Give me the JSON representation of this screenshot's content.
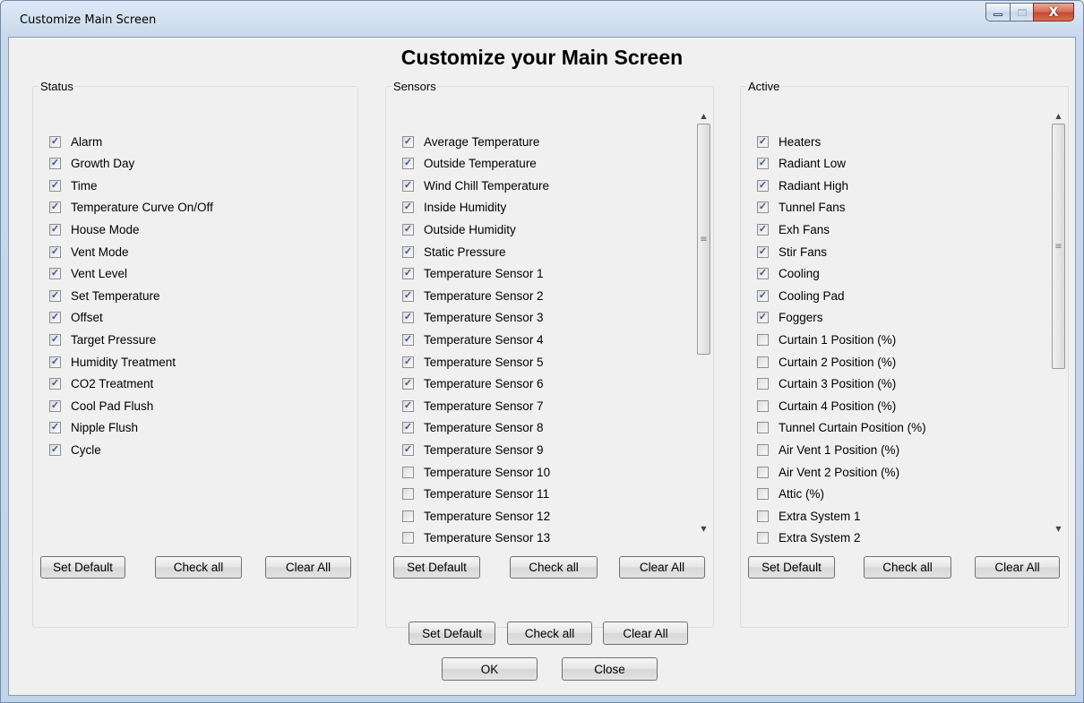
{
  "window": {
    "title": "Customize Main Screen",
    "controls": {
      "minimize": "minimize-icon",
      "maximize": "maximize-icon",
      "close": "close-icon",
      "close_glyph": "X"
    }
  },
  "heading": "Customize your Main Screen",
  "groups": [
    {
      "title": "Status",
      "items": [
        {
          "label": "Alarm",
          "checked": true
        },
        {
          "label": "Growth Day",
          "checked": true
        },
        {
          "label": "Time",
          "checked": true
        },
        {
          "label": "Temperature Curve On/Off",
          "checked": true
        },
        {
          "label": "House Mode",
          "checked": true
        },
        {
          "label": "Vent Mode",
          "checked": true
        },
        {
          "label": "Vent Level",
          "checked": true
        },
        {
          "label": "Set Temperature",
          "checked": true
        },
        {
          "label": "Offset",
          "checked": true
        },
        {
          "label": "Target Pressure",
          "checked": true
        },
        {
          "label": "Humidity Treatment",
          "checked": true
        },
        {
          "label": "CO2 Treatment",
          "checked": true
        },
        {
          "label": "Cool Pad Flush",
          "checked": true
        },
        {
          "label": "Nipple Flush",
          "checked": true
        },
        {
          "label": "Cycle",
          "checked": true
        }
      ],
      "buttons": {
        "set_default": "Set Default",
        "check_all": "Check all",
        "clear_all": "Clear All"
      }
    },
    {
      "title": "Sensors",
      "items": [
        {
          "label": "Average Temperature",
          "checked": true
        },
        {
          "label": "Outside Temperature",
          "checked": true
        },
        {
          "label": "Wind Chill Temperature",
          "checked": true
        },
        {
          "label": "Inside Humidity",
          "checked": true
        },
        {
          "label": "Outside Humidity",
          "checked": true
        },
        {
          "label": "Static Pressure",
          "checked": true
        },
        {
          "label": "Temperature Sensor 1",
          "checked": true
        },
        {
          "label": "Temperature Sensor 2",
          "checked": true
        },
        {
          "label": "Temperature Sensor 3",
          "checked": true
        },
        {
          "label": "Temperature Sensor 4",
          "checked": true
        },
        {
          "label": "Temperature Sensor 5",
          "checked": true
        },
        {
          "label": "Temperature Sensor 6",
          "checked": true
        },
        {
          "label": "Temperature Sensor 7",
          "checked": true
        },
        {
          "label": "Temperature Sensor 8",
          "checked": true
        },
        {
          "label": "Temperature Sensor 9",
          "checked": true
        },
        {
          "label": "Temperature Sensor 10",
          "checked": false
        },
        {
          "label": "Temperature Sensor 11",
          "checked": false
        },
        {
          "label": "Temperature Sensor 12",
          "checked": false
        },
        {
          "label": "Temperature Sensor 13",
          "checked": false
        }
      ],
      "buttons": {
        "set_default": "Set Default",
        "check_all": "Check all",
        "clear_all": "Clear All"
      }
    },
    {
      "title": "Active",
      "items": [
        {
          "label": "Heaters",
          "checked": true
        },
        {
          "label": "Radiant Low",
          "checked": true
        },
        {
          "label": "Radiant High",
          "checked": true
        },
        {
          "label": "Tunnel Fans",
          "checked": true
        },
        {
          "label": "Exh Fans",
          "checked": true
        },
        {
          "label": "Stir Fans",
          "checked": true
        },
        {
          "label": "Cooling",
          "checked": true
        },
        {
          "label": "Cooling Pad",
          "checked": true
        },
        {
          "label": "Foggers",
          "checked": true
        },
        {
          "label": "Curtain 1 Position (%)",
          "checked": false
        },
        {
          "label": "Curtain 2 Position (%)",
          "checked": false
        },
        {
          "label": "Curtain 3 Position (%)",
          "checked": false
        },
        {
          "label": "Curtain 4 Position (%)",
          "checked": false
        },
        {
          "label": "Tunnel Curtain Position (%)",
          "checked": false
        },
        {
          "label": "Air Vent 1 Position (%)",
          "checked": false
        },
        {
          "label": "Air Vent 2 Position (%)",
          "checked": false
        },
        {
          "label": "Attic (%)",
          "checked": false
        },
        {
          "label": "Extra System 1",
          "checked": false
        },
        {
          "label": "Extra System 2",
          "checked": false
        }
      ],
      "buttons": {
        "set_default": "Set Default",
        "check_all": "Check all",
        "clear_all": "Clear All"
      }
    }
  ],
  "footer": {
    "set_default": "Set Default",
    "check_all": "Check all",
    "clear_all": "Clear All",
    "ok": "OK",
    "close": "Close"
  }
}
